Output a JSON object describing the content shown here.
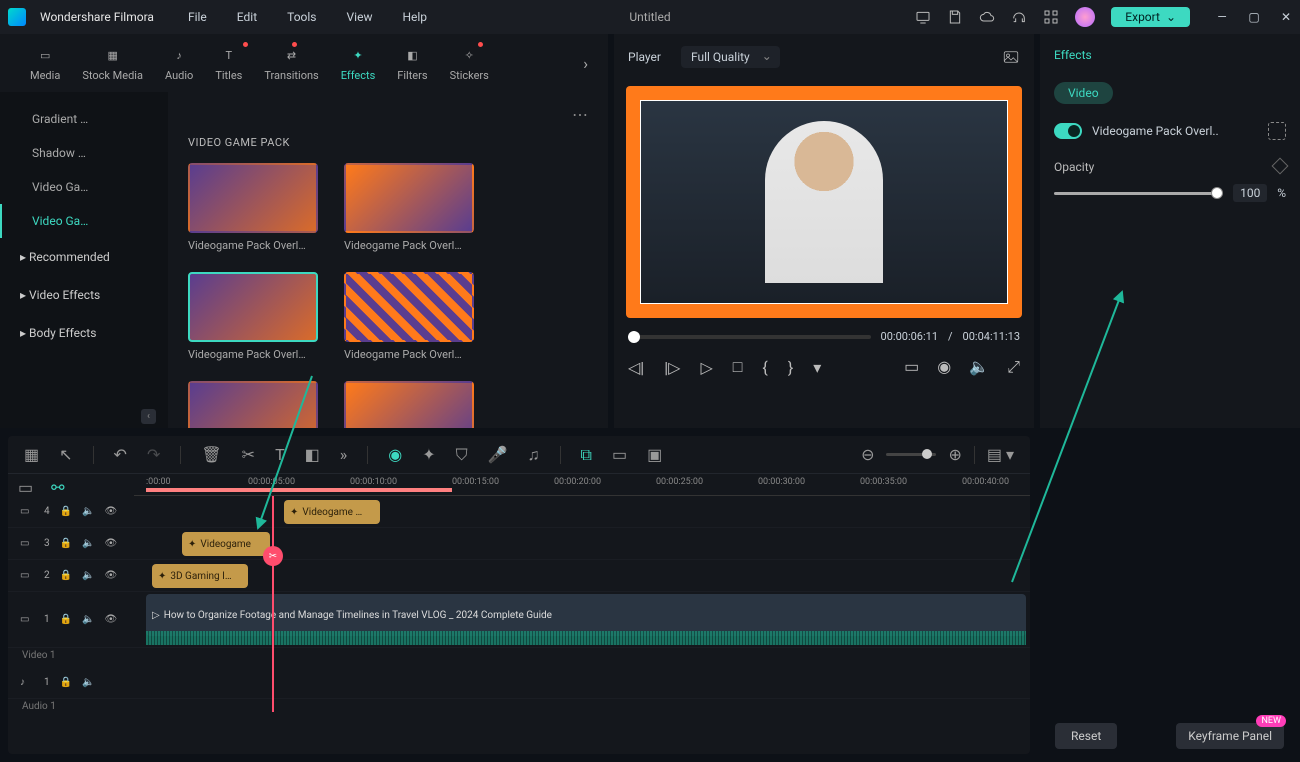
{
  "app": {
    "name": "Wondershare Filmora",
    "doc": "Untitled"
  },
  "menus": [
    "File",
    "Edit",
    "Tools",
    "View",
    "Help"
  ],
  "export_label": "Export",
  "tabs": [
    {
      "label": "Media"
    },
    {
      "label": "Stock Media"
    },
    {
      "label": "Audio"
    },
    {
      "label": "Titles"
    },
    {
      "label": "Transitions"
    },
    {
      "label": "Effects",
      "active": true
    },
    {
      "label": "Filters"
    },
    {
      "label": "Stickers"
    }
  ],
  "sidebar": {
    "items": [
      "Gradient …",
      "Shadow …",
      "Video Ga…",
      "Video Ga…"
    ],
    "groups": [
      "Recommended",
      "Video Effects",
      "Body Effects"
    ],
    "selected": 3
  },
  "gallery": {
    "title": "VIDEO GAME PACK",
    "items": [
      {
        "label": "Videogame Pack Overl…"
      },
      {
        "label": "Videogame Pack Overl…"
      },
      {
        "label": "Videogame Pack Overl…",
        "sel": true
      },
      {
        "label": "Videogame Pack Overl…"
      },
      {
        "label": ""
      },
      {
        "label": ""
      }
    ]
  },
  "player": {
    "label": "Player",
    "quality": "Full Quality",
    "current": "00:00:06:11",
    "sep": "/",
    "total": "00:04:11:13"
  },
  "right": {
    "tab": "Effects",
    "pill": "Video",
    "name": "Videogame Pack Overl..",
    "opacity_label": "Opacity",
    "opacity_value": "100",
    "opacity_unit": "%",
    "reset": "Reset",
    "keyframe": "Keyframe Panel",
    "new": "NEW"
  },
  "timeline": {
    "marks": [
      ":00:00",
      "00:00:05:00",
      "00:00:10:00",
      "00:00:15:00",
      "00:00:20:00",
      "00:00:25:00",
      "00:00:30:00",
      "00:00:35:00",
      "00:00:40:00"
    ],
    "tracks": {
      "fx4": "4",
      "fx3": "3",
      "fx2": "2",
      "vid": "1",
      "vlab": "Video 1",
      "aud": "1",
      "alab": "Audio 1"
    },
    "clips": {
      "fx4": "Videogame …",
      "fx3": "Videogame",
      "fx2": "3D Gaming I…",
      "vid": "How to Organize Footage and Manage Timelines in Travel VLOG _ 2024 Complete Guide"
    }
  }
}
